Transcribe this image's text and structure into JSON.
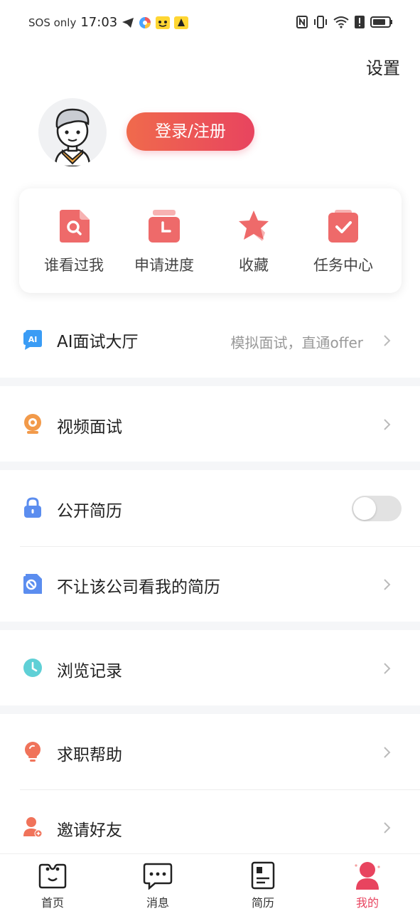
{
  "status_bar": {
    "carrier": "SOS only",
    "time": "17:03"
  },
  "header": {
    "settings_label": "设置"
  },
  "profile": {
    "login_label": "登录/注册"
  },
  "quick_actions": [
    {
      "label": "谁看过我",
      "icon": "magnifier-document-icon"
    },
    {
      "label": "申请进度",
      "icon": "clock-calendar-icon"
    },
    {
      "label": "收藏",
      "icon": "star-icon"
    },
    {
      "label": "任务中心",
      "icon": "checklist-icon"
    }
  ],
  "menu": {
    "ai_interview": {
      "label": "AI面试大厅",
      "subtitle": "模拟面试，直通offer",
      "icon_text": "AI"
    },
    "video_interview": {
      "label": "视频面试"
    },
    "public_resume": {
      "label": "公开简历",
      "enabled": false
    },
    "block_company": {
      "label": "不让该公司看我的简历"
    },
    "browse_history": {
      "label": "浏览记录"
    },
    "job_help": {
      "label": "求职帮助"
    },
    "invite_friends": {
      "label": "邀请好友"
    }
  },
  "bottom_nav": [
    {
      "label": "首页",
      "active": false
    },
    {
      "label": "消息",
      "active": false
    },
    {
      "label": "简历",
      "active": false
    },
    {
      "label": "我的",
      "active": true
    }
  ],
  "colors": {
    "accent": "#e8445f",
    "accent_light": "#f06a4c",
    "background_gap": "#f5f6f8"
  }
}
